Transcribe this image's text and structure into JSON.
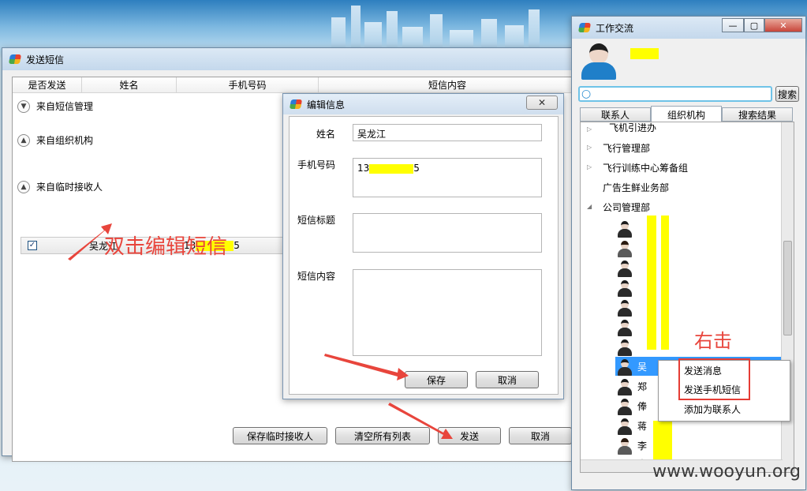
{
  "sms_window": {
    "title": "发送短信",
    "columns": [
      "是否发送",
      "姓名",
      "手机号码",
      "短信内容"
    ],
    "groups": [
      {
        "label": "来自短信管理"
      },
      {
        "label": "来自组织机构"
      },
      {
        "label": "来自临时接收人"
      }
    ],
    "recipient": {
      "name": "吴龙江",
      "phone_prefix": "13",
      "phone_suffix": "5",
      "checked_mark": "✓"
    },
    "buttons": {
      "save_temp": "保存临时接收人",
      "clear_all": "清空所有列表",
      "send": "发送",
      "cancel": "取消"
    }
  },
  "annotations": {
    "double_click": "双击编辑短信",
    "right_click": "右击"
  },
  "edit_dialog": {
    "title": "编辑信息",
    "close_glyph": "✕",
    "labels": {
      "name": "姓名",
      "phone": "手机号码",
      "subject": "短信标题",
      "content": "短信内容"
    },
    "values": {
      "name": "吴龙江",
      "phone_prefix": "13",
      "phone_suffix": "5",
      "subject": "",
      "content": ""
    },
    "buttons": {
      "save": "保存",
      "cancel": "取消"
    }
  },
  "work_window": {
    "title": "工作交流",
    "title_buttons": {
      "min": "—",
      "max": "▢",
      "close": "✕"
    },
    "search": {
      "value": "",
      "button": "搜索"
    },
    "tabs": [
      {
        "label": "联系人"
      },
      {
        "label": "组织机构",
        "active": true
      },
      {
        "label": "搜索结果"
      }
    ],
    "tree": {
      "nodes": [
        "飞机引进办",
        "飞行管理部",
        "飞行训练中心筹备组",
        "广告生鲜业务部",
        "公司管理部"
      ],
      "members_visible_text": [
        "吴",
        "郑",
        "俸",
        "蒋",
        "李",
        "李"
      ]
    },
    "context_menu": {
      "items": [
        "发送消息",
        "发送手机短信",
        "添加为联系人"
      ]
    }
  },
  "watermark": "www.wooyun.org"
}
